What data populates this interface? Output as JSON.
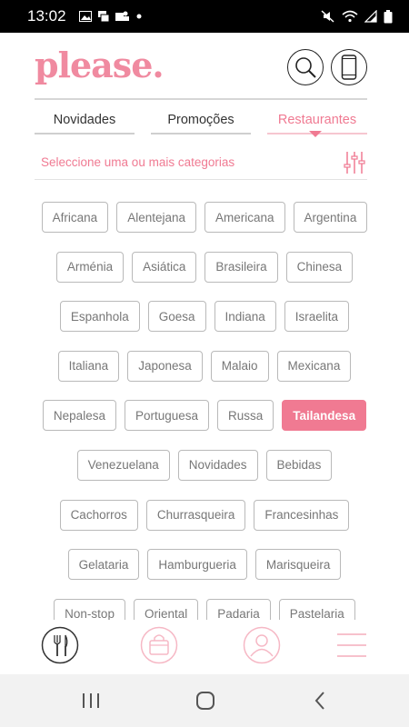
{
  "status_bar": {
    "time": "13:02",
    "left_icons": [
      "image-icon",
      "account-switch-icon",
      "teams-icon",
      "dot-icon"
    ],
    "right_icons": [
      "mute-icon",
      "wifi-icon",
      "signal-icon",
      "battery-icon"
    ]
  },
  "header": {
    "logo": "please.",
    "search_icon": "search-icon",
    "phone_icon": "phone-icon"
  },
  "tabs": [
    {
      "label": "Novidades",
      "active": false
    },
    {
      "label": "Promoções",
      "active": false
    },
    {
      "label": "Restaurantes",
      "active": true
    }
  ],
  "filter": {
    "label": "Seleccione uma ou mais categorias",
    "icon": "sliders-icon"
  },
  "categories": {
    "selected": "Tailandesa",
    "rows": [
      [
        "Africana",
        "Alentejana",
        "Americana",
        "Argentina"
      ],
      [
        "Arménia",
        "Asiática",
        "Brasileira",
        "Chinesa"
      ],
      [
        "Espanhola",
        "Goesa",
        "Indiana",
        "Israelita"
      ],
      [
        "Italiana",
        "Japonesa",
        "Malaio",
        "Mexicana"
      ],
      [
        "Nepalesa",
        "Portuguesa",
        "Russa",
        "Tailandesa"
      ],
      [
        "Venezuelana",
        "Novidades",
        "Bebidas"
      ],
      [
        "Cachorros",
        "Churrasqueira",
        "Francesinhas"
      ],
      [
        "Gelataria",
        "Hamburgueria",
        "Marisqueira"
      ],
      [
        "Non-stop",
        "Oriental",
        "Padaria",
        "Pastelaria"
      ]
    ]
  },
  "bottom_nav": [
    {
      "name": "restaurants",
      "icon": "fork-knife-icon",
      "active": true
    },
    {
      "name": "orders",
      "icon": "shopping-bag-icon",
      "active": false
    },
    {
      "name": "profile",
      "icon": "user-icon",
      "active": false
    },
    {
      "name": "menu",
      "icon": "hamburger-menu-icon",
      "active": false
    }
  ],
  "colors": {
    "accent": "#f07a92",
    "accent_light": "#f6c6d0",
    "chip_border": "#b9b9b9",
    "chip_text": "#777777"
  }
}
